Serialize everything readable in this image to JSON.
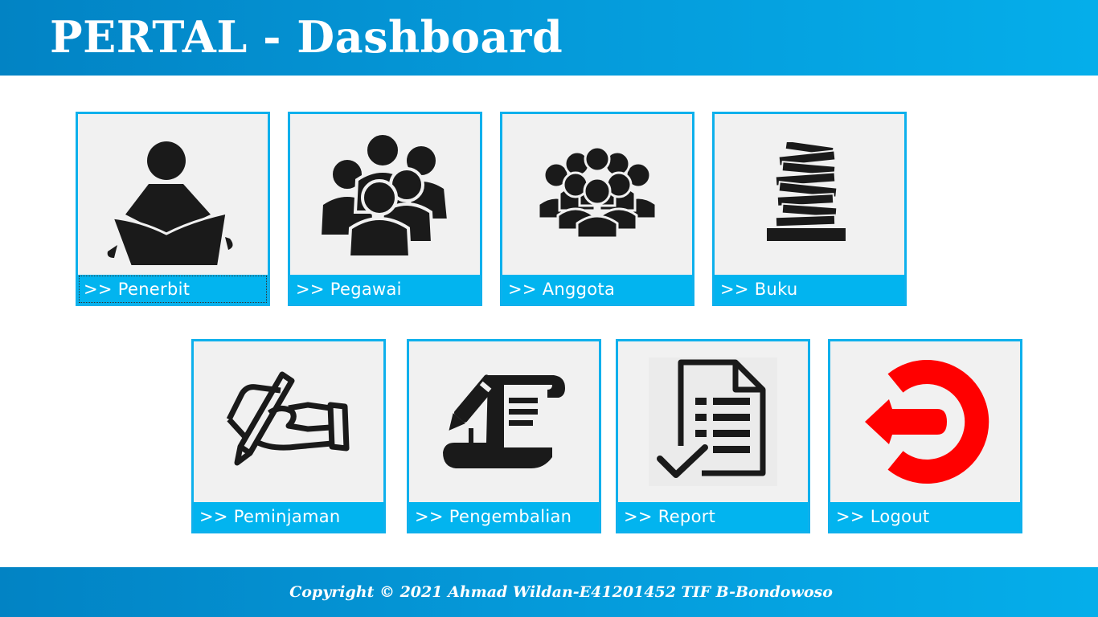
{
  "header": {
    "title": "PERTAL - Dashboard"
  },
  "tiles": [
    {
      "label": ">> Penerbit",
      "icon": "reading-person-icon"
    },
    {
      "label": ">> Pegawai",
      "icon": "group-icon"
    },
    {
      "label": ">> Anggota",
      "icon": "crowd-icon"
    },
    {
      "label": ">> Buku",
      "icon": "books-stack-icon"
    },
    {
      "label": ">> Peminjaman",
      "icon": "hand-pen-icon"
    },
    {
      "label": ">> Pengembalian",
      "icon": "scroll-pen-icon"
    },
    {
      "label": ">> Report",
      "icon": "report-document-icon"
    },
    {
      "label": ">> Logout",
      "icon": "logout-icon"
    }
  ],
  "colors": {
    "header": "#0598d8",
    "accent": "#02b4ef",
    "tile_bg": "#f1f1f1",
    "icon": "#1a1a1a",
    "logout": "#ff0000"
  },
  "footer": {
    "copyright": "Copyright © 2021 Ahmad Wildan-E41201452 TIF B-Bondowoso"
  }
}
